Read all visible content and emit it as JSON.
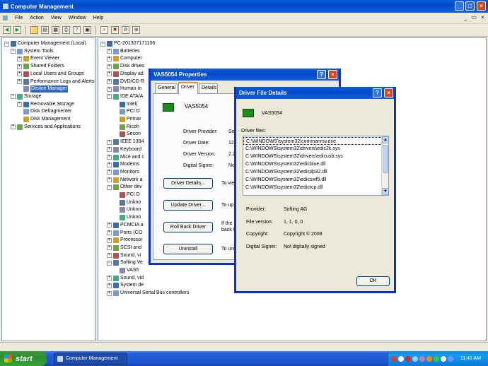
{
  "main": {
    "title": "Computer Management",
    "menu": [
      "File",
      "Action",
      "View",
      "Window",
      "Help"
    ],
    "left_tree": [
      {
        "label": "Computer Management (Local)",
        "indent": 0,
        "exp": "−"
      },
      {
        "label": "System Tools",
        "indent": 1,
        "exp": "−"
      },
      {
        "label": "Event Viewer",
        "indent": 2,
        "exp": "+"
      },
      {
        "label": "Shared Folders",
        "indent": 2,
        "exp": "+"
      },
      {
        "label": "Local Users and Groups",
        "indent": 2,
        "exp": "+"
      },
      {
        "label": "Performance Logs and Alerts",
        "indent": 2,
        "exp": "+"
      },
      {
        "label": "Device Manager",
        "indent": 2,
        "exp": "",
        "selected": true
      },
      {
        "label": "Storage",
        "indent": 1,
        "exp": "−"
      },
      {
        "label": "Removable Storage",
        "indent": 2,
        "exp": "+"
      },
      {
        "label": "Disk Defragmenter",
        "indent": 2,
        "exp": ""
      },
      {
        "label": "Disk Management",
        "indent": 2,
        "exp": ""
      },
      {
        "label": "Services and Applications",
        "indent": 1,
        "exp": "+"
      }
    ],
    "right_tree": [
      {
        "label": "PC-201307171106",
        "indent": 0,
        "exp": "−"
      },
      {
        "label": "Batteries",
        "indent": 1,
        "exp": "+"
      },
      {
        "label": "Computer",
        "indent": 1,
        "exp": "+"
      },
      {
        "label": "Disk drives",
        "indent": 1,
        "exp": "+"
      },
      {
        "label": "Display ad",
        "indent": 1,
        "exp": "+"
      },
      {
        "label": "DVD/CD-R",
        "indent": 1,
        "exp": "+"
      },
      {
        "label": "Human In",
        "indent": 1,
        "exp": "+"
      },
      {
        "label": "IDE ATA/A",
        "indent": 1,
        "exp": "−"
      },
      {
        "label": "Intel(",
        "indent": 2,
        "exp": ""
      },
      {
        "label": "PCI D",
        "indent": 2,
        "exp": ""
      },
      {
        "label": "Primar",
        "indent": 2,
        "exp": ""
      },
      {
        "label": "Ricoh",
        "indent": 2,
        "exp": ""
      },
      {
        "label": "Secon",
        "indent": 2,
        "exp": ""
      },
      {
        "label": "IEEE 1394",
        "indent": 1,
        "exp": "+"
      },
      {
        "label": "Keyboard",
        "indent": 1,
        "exp": "+"
      },
      {
        "label": "Mice and c",
        "indent": 1,
        "exp": "+"
      },
      {
        "label": "Modems",
        "indent": 1,
        "exp": "+"
      },
      {
        "label": "Monitors",
        "indent": 1,
        "exp": "+"
      },
      {
        "label": "Network a",
        "indent": 1,
        "exp": "+"
      },
      {
        "label": "Other dev",
        "indent": 1,
        "exp": "−"
      },
      {
        "label": "PCI D",
        "indent": 2,
        "exp": ""
      },
      {
        "label": "Unkno",
        "indent": 2,
        "exp": ""
      },
      {
        "label": "Unkno",
        "indent": 2,
        "exp": ""
      },
      {
        "label": "Unkno",
        "indent": 2,
        "exp": ""
      },
      {
        "label": "PCMCIA a",
        "indent": 1,
        "exp": "+"
      },
      {
        "label": "Ports (CO",
        "indent": 1,
        "exp": "+"
      },
      {
        "label": "Processor",
        "indent": 1,
        "exp": "+"
      },
      {
        "label": "SCSI and",
        "indent": 1,
        "exp": "+"
      },
      {
        "label": "Sound, vi",
        "indent": 1,
        "exp": "+"
      },
      {
        "label": "Softing Ve",
        "indent": 1,
        "exp": "−"
      },
      {
        "label": "VAS5",
        "indent": 2,
        "exp": ""
      },
      {
        "label": "Sound, vid",
        "indent": 1,
        "exp": "+"
      },
      {
        "label": "System de",
        "indent": 1,
        "exp": "+"
      },
      {
        "label": "Universal Serial Bus controllers",
        "indent": 1,
        "exp": "+"
      }
    ]
  },
  "props": {
    "title": "VAS5054 Properties",
    "tabs": [
      "General",
      "Driver",
      "Details"
    ],
    "device_name": "VAS5054",
    "fields": [
      {
        "label": "Driver Provider:",
        "value": "Soft"
      },
      {
        "label": "Driver Date:",
        "value": "12/"
      },
      {
        "label": "Driver Version:",
        "value": "2.2"
      },
      {
        "label": "Digital Signer:",
        "value": "Not"
      }
    ],
    "buttons": [
      {
        "label": "Driver Details...",
        "desc": "To vie"
      },
      {
        "label": "Update Driver...",
        "desc": "To up"
      },
      {
        "label": "Roll Back Driver",
        "desc": "If the",
        "desc2": "back t"
      },
      {
        "label": "Uninstall",
        "desc": "To uni"
      }
    ]
  },
  "details": {
    "title": "Driver File Details",
    "device_name": "VAS5054",
    "files_label": "Driver files:",
    "files": [
      "C:\\WINDOWS\\system32\\commanrsv.exe",
      "C:\\WINDOWS\\system32\\drivers\\edic2k.sys",
      "C:\\WINDOWS\\system32\\drivers\\edicusb.sys",
      "C:\\WINDOWS\\system32\\edicblue.dll",
      "C:\\WINDOWS\\system32\\edicdp32.dll",
      "C:\\WINDOWS\\system32\\edicswf5.dll",
      "C:\\WINDOWS\\system32\\edictcp.dll"
    ],
    "info": [
      {
        "label": "Provider:",
        "value": "Softing AG"
      },
      {
        "label": "File version:",
        "value": "1, 1, 0, 0"
      },
      {
        "label": "Copyright:",
        "value": "Copyright © 2008"
      },
      {
        "label": "Digital Signer:",
        "value": "Not digitally signed"
      }
    ],
    "ok_label": "OK"
  },
  "taskbar": {
    "start_label": "start",
    "task_label": "Computer Management",
    "clock": "11:41 AM"
  }
}
